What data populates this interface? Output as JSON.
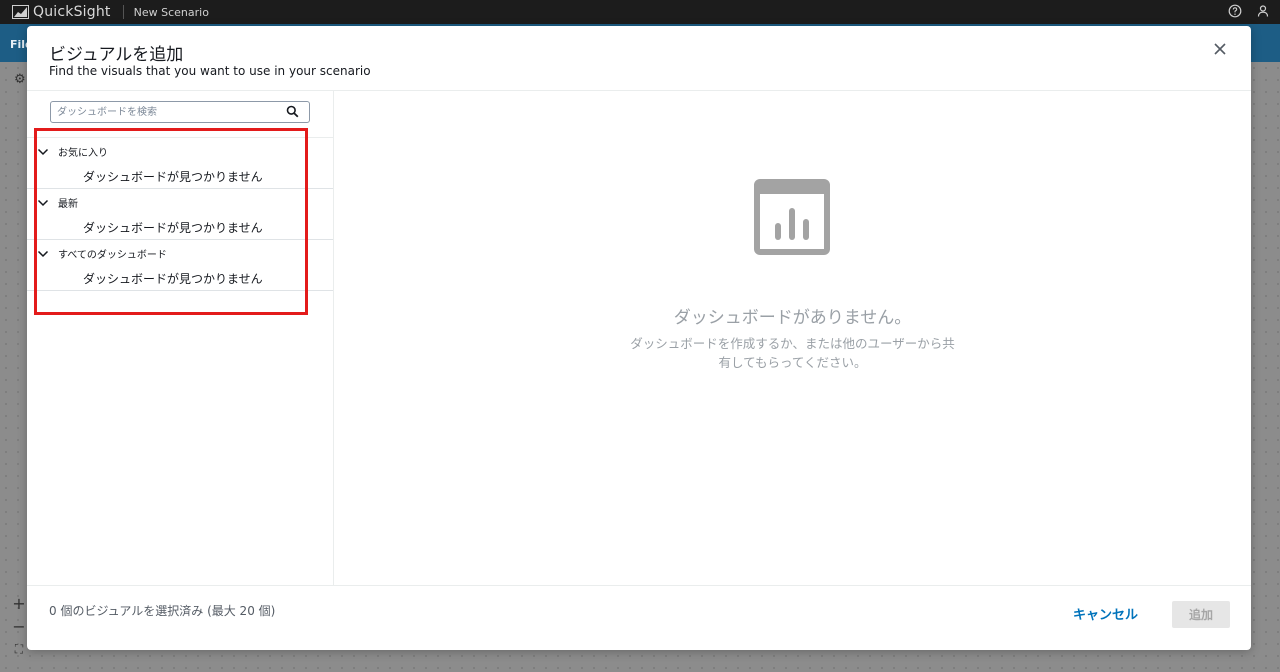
{
  "app": {
    "name": "QuickSight",
    "scenario": "New Scenario",
    "menu_file": "File"
  },
  "modal": {
    "title": "ビジュアルを追加",
    "subtitle": "Find the visuals that you want to use in your scenario",
    "search": {
      "placeholder": "ダッシュボードを検索",
      "value": ""
    },
    "sections": [
      {
        "label": "お気に入り",
        "empty": "ダッシュボードが見つかりません"
      },
      {
        "label": "最新",
        "empty": "ダッシュボードが見つかりません"
      },
      {
        "label": "すべてのダッシュボード",
        "empty": "ダッシュボードが見つかりません"
      }
    ],
    "empty_state": {
      "title": "ダッシュボードがありません。",
      "desc_line1": "ダッシュボードを作成するか、または他のユーザーから共",
      "desc_line2": "有してもらってください。"
    },
    "footer": {
      "status": "0 個のビジュアルを選択済み (最大 20 個)",
      "cancel": "キャンセル",
      "add": "追加"
    }
  },
  "colors": {
    "accent": "#0073bb",
    "highlight": "#e31b1b",
    "menubar": "#1d5d85"
  }
}
